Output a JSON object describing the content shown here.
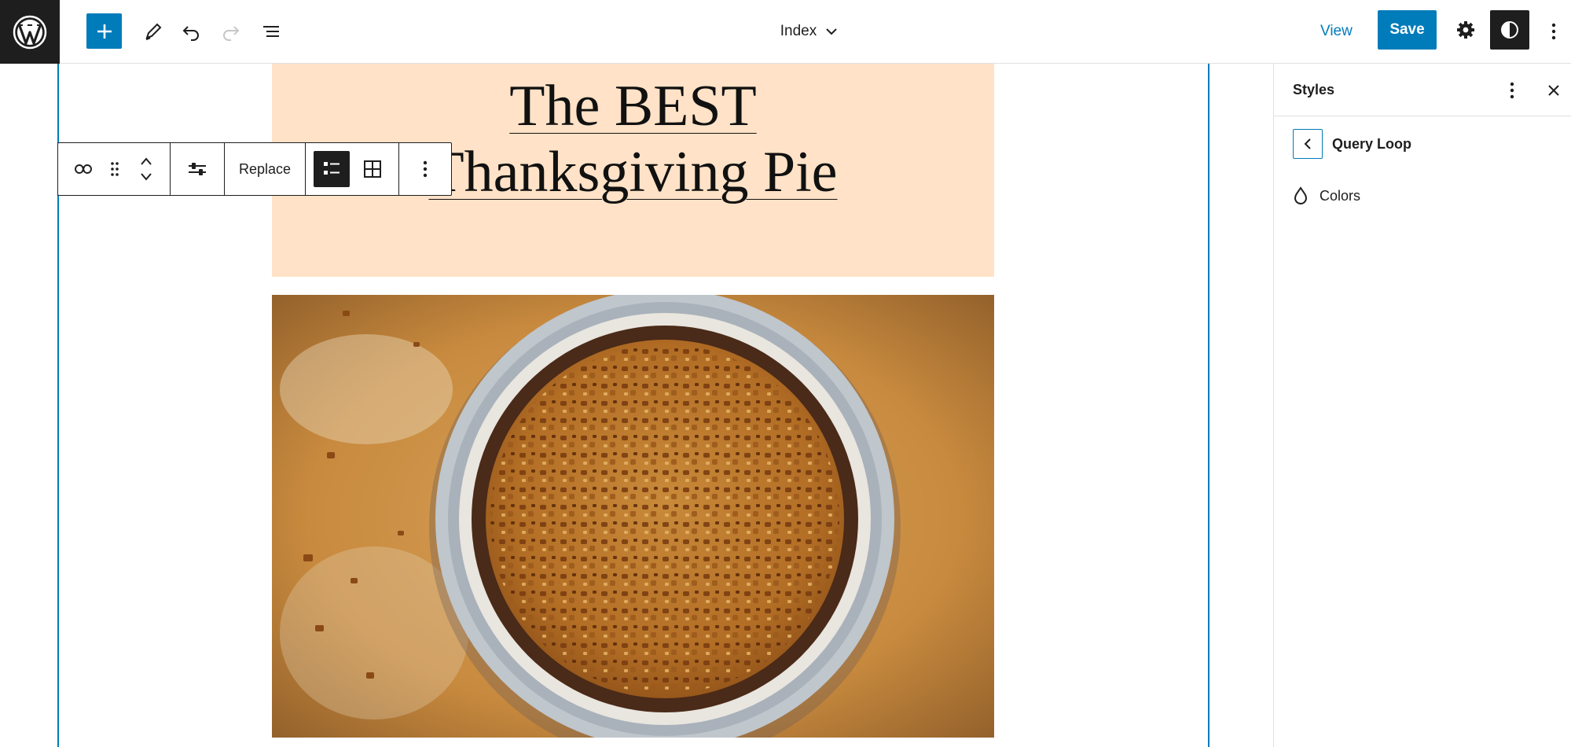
{
  "header": {
    "document_title": "Index",
    "view_label": "View",
    "save_label": "Save",
    "icons": [
      "wordpress-logo",
      "plus-icon",
      "pencil-icon",
      "undo-icon",
      "redo-icon",
      "list-view-icon",
      "chevron-down-icon",
      "gear-icon",
      "half-circle-contrast-icon",
      "vertical-dots-icon"
    ]
  },
  "block_toolbar": {
    "replace_label": "Replace",
    "icons": [
      "link-icon",
      "drag-handle-icon",
      "chevron-up-icon",
      "chevron-down-icon",
      "sliders-icon",
      "list-layout-icon",
      "grid-layout-icon",
      "vertical-dots-icon"
    ],
    "active_layout": "list"
  },
  "post": {
    "title_line1": "The BEST",
    "title_line2": "Thanksgiving Pie",
    "title_background": "#ffe2c7"
  },
  "sidebar": {
    "title": "Styles",
    "nav_title": "Query Loop",
    "items": [
      {
        "label": "Colors",
        "icon": "droplet-icon"
      }
    ]
  },
  "colors": {
    "accent": "#007cba",
    "dark": "#1e1e1e"
  }
}
